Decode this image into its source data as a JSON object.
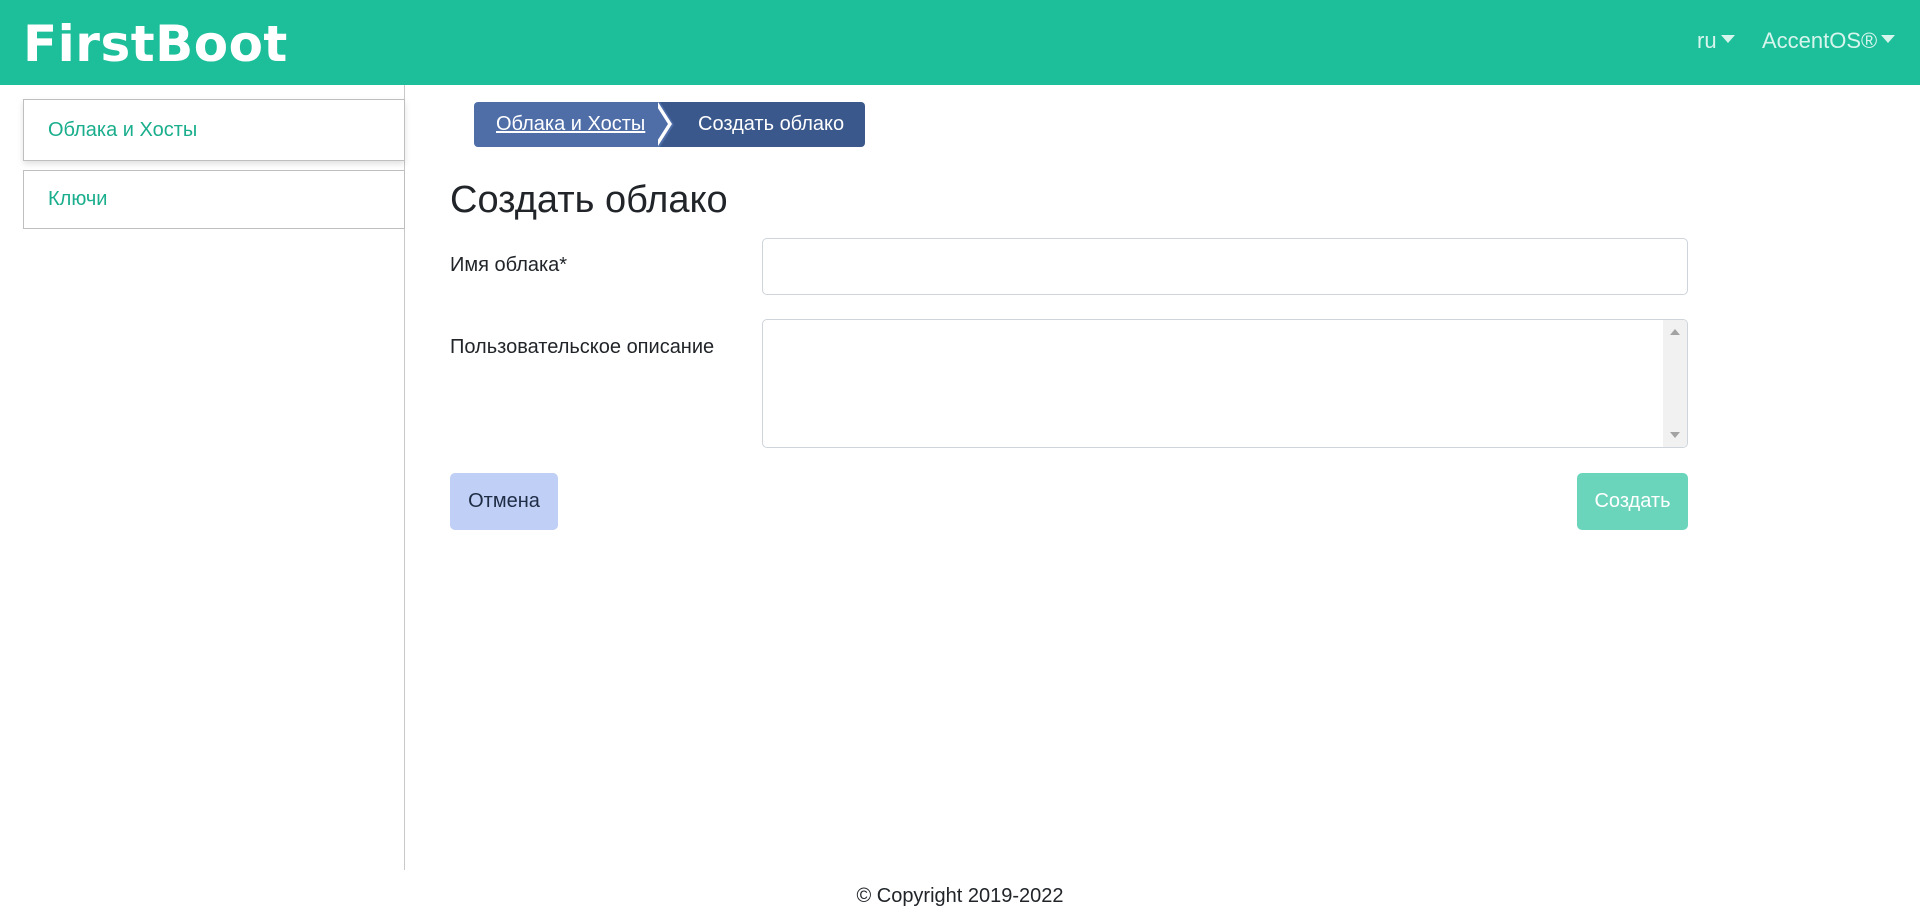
{
  "header": {
    "logo": "FirstBoot",
    "language": "ru",
    "organization": "AccentOS®"
  },
  "sidebar": {
    "items": [
      {
        "label": "Облака и Хосты",
        "active": true
      },
      {
        "label": "Ключи",
        "active": false
      }
    ]
  },
  "breadcrumb": {
    "parent": "Облака и Хосты",
    "current": "Создать облако"
  },
  "page": {
    "title": "Создать облако"
  },
  "form": {
    "name_label": "Имя облака*",
    "name_value": "",
    "description_label": "Пользовательское описание",
    "description_value": "",
    "cancel_label": "Отмена",
    "create_label": "Создать"
  },
  "footer": {
    "copyright": "© Copyright 2019-2022"
  },
  "colors": {
    "navbar": "#1dbf9b",
    "accent_text": "#1aae8d",
    "breadcrumb_parent": "#4f6ea8",
    "breadcrumb_current": "#3a588b",
    "cancel_button": "#bfcff5",
    "create_button": "#6bd5bc"
  }
}
